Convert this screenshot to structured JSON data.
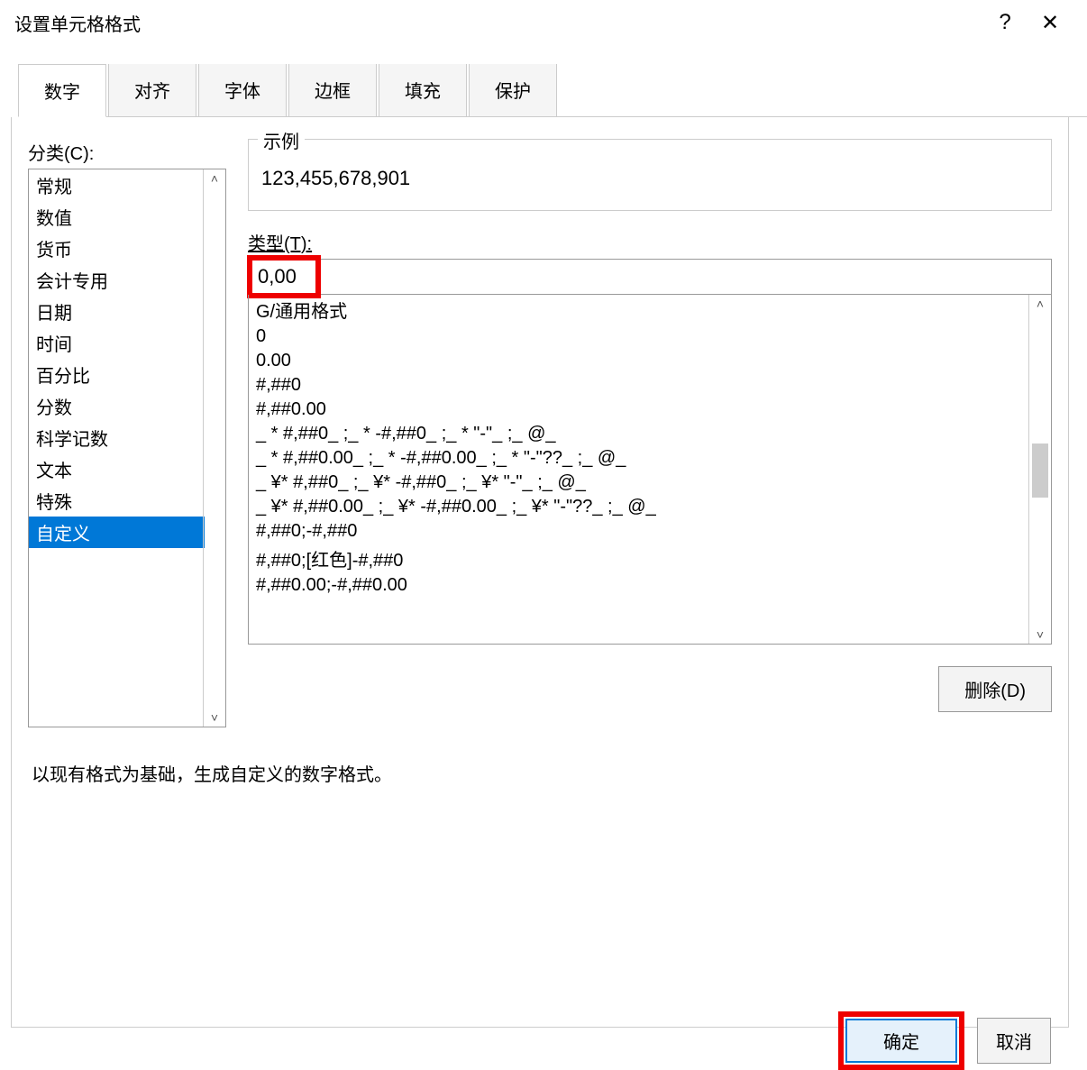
{
  "window": {
    "title": "设置单元格格式",
    "help": "?",
    "close": "✕"
  },
  "tabs": [
    "数字",
    "对齐",
    "字体",
    "边框",
    "填充",
    "保护"
  ],
  "active_tab_index": 0,
  "category": {
    "label": "分类(C):",
    "items": [
      "常规",
      "数值",
      "货币",
      "会计专用",
      "日期",
      "时间",
      "百分比",
      "分数",
      "科学记数",
      "文本",
      "特殊",
      "自定义"
    ],
    "selected_index": 11
  },
  "sample": {
    "legend": "示例",
    "value": "123,455,678,901"
  },
  "type": {
    "label": "类型(T):",
    "value": "0,00"
  },
  "format_list": [
    "G/通用格式",
    "0",
    "0.00",
    "#,##0",
    "#,##0.00",
    "_ * #,##0_ ;_ * -#,##0_ ;_ * \"-\"_ ;_ @_",
    "_ * #,##0.00_ ;_ * -#,##0.00_ ;_ * \"-\"??_ ;_ @_",
    "_ ¥* #,##0_ ;_ ¥* -#,##0_ ;_ ¥* \"-\"_ ;_ @_",
    "_ ¥* #,##0.00_ ;_ ¥* -#,##0.00_ ;_ ¥* \"-\"??_ ;_ @_",
    "#,##0;-#,##0",
    "#,##0;[红色]-#,##0",
    "#,##0.00;-#,##0.00"
  ],
  "buttons": {
    "delete": "删除(D)",
    "ok": "确定",
    "cancel": "取消"
  },
  "description": "以现有格式为基础，生成自定义的数字格式。",
  "scroll_arrows": {
    "up": "˄",
    "down": "˅"
  }
}
